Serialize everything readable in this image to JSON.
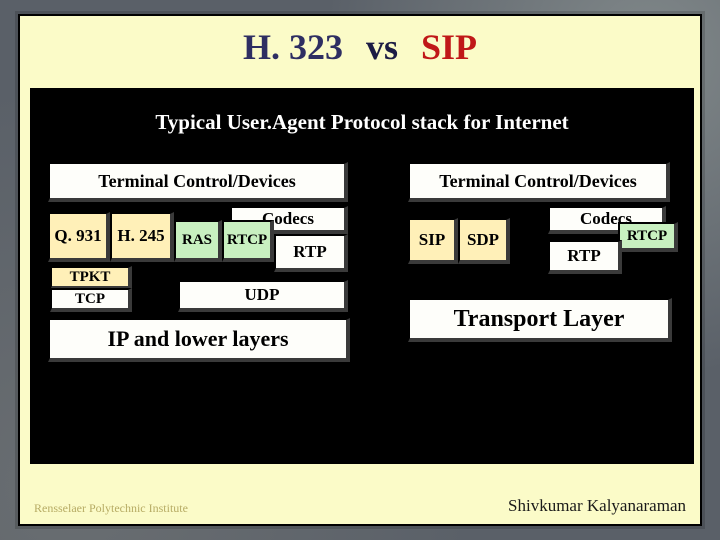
{
  "title": {
    "h323": "H. 323",
    "vs": "vs",
    "sip": "SIP"
  },
  "subtitle": "Typical User.Agent Protocol stack for Internet",
  "left": {
    "terminal": "Terminal Control/Devices",
    "q931": "Q. 931",
    "h245": "H. 245",
    "ras": "RAS",
    "rtcp": "RTCP",
    "codecs": "Codecs",
    "rtp": "RTP",
    "tpkt": "TPKT",
    "tcp": "TCP",
    "udp": "UDP",
    "ip": "IP and lower layers"
  },
  "right": {
    "terminal": "Terminal Control/Devices",
    "sip": "SIP",
    "sdp": "SDP",
    "codecs": "Codecs",
    "rtcp": "RTCP",
    "rtp": "RTP",
    "transport": "Transport Layer"
  },
  "footer": {
    "left": "Rensselaer Polytechnic Institute",
    "right": "Shivkumar Kalyanaraman"
  }
}
